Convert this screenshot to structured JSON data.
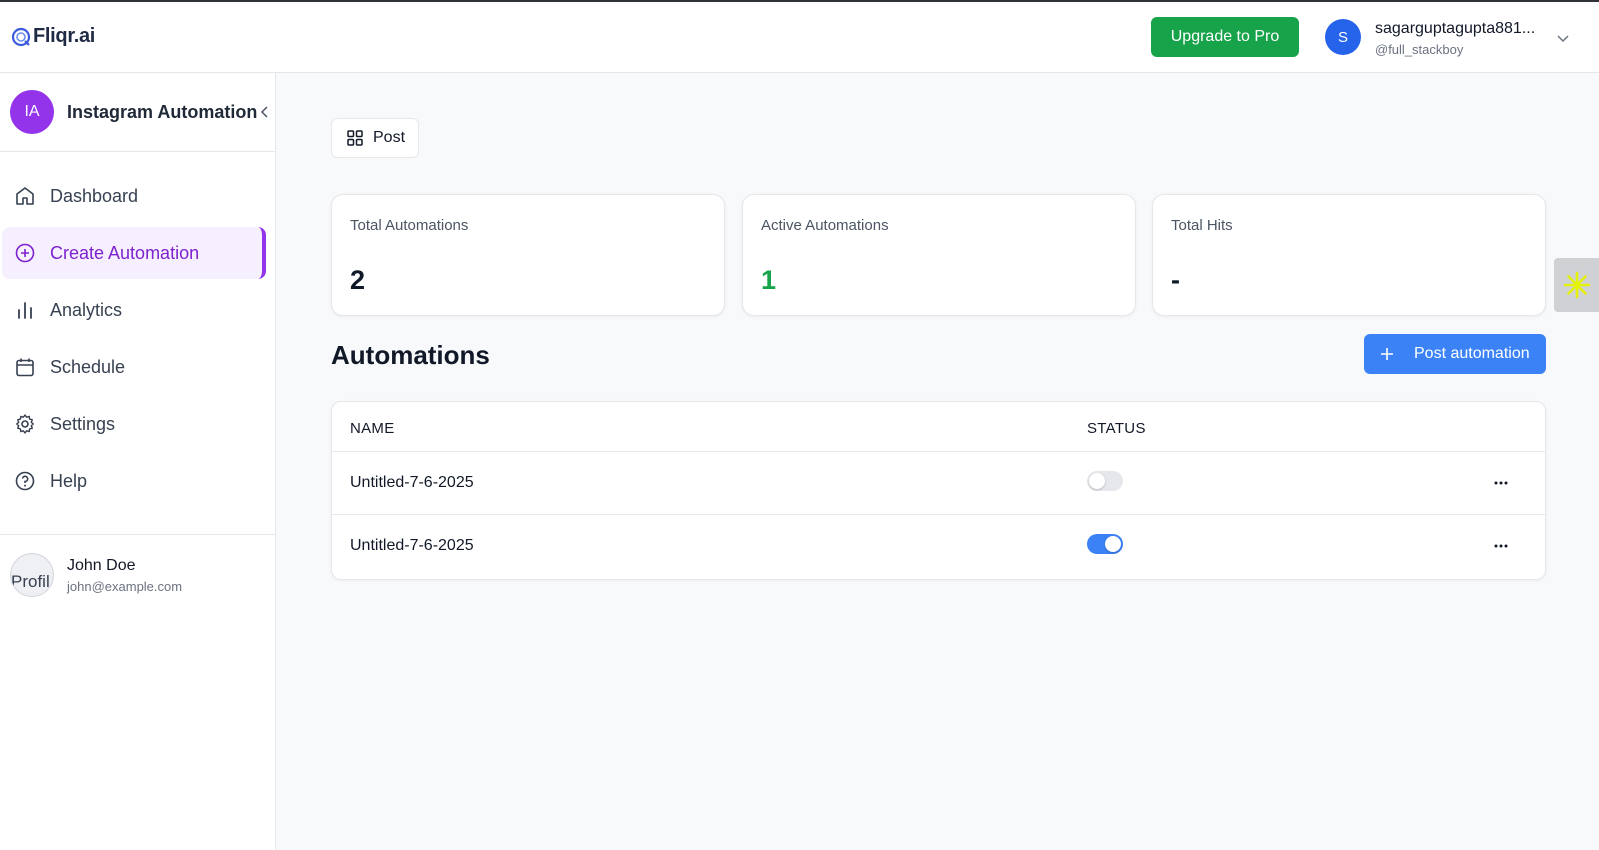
{
  "header": {
    "logo_text": "Fliqr.ai",
    "upgrade_label": "Upgrade to Pro",
    "user": {
      "initial": "S",
      "name": "sagarguptagupta881...",
      "handle": "@full_stackboy"
    }
  },
  "sidebar": {
    "workspace": {
      "initials": "IA",
      "name": "Instagram Automation"
    },
    "items": [
      {
        "label": "Dashboard",
        "icon": "home-icon",
        "active": false
      },
      {
        "label": "Create Automation",
        "icon": "plus-circle-icon",
        "active": true
      },
      {
        "label": "Analytics",
        "icon": "bar-chart-icon",
        "active": false
      },
      {
        "label": "Schedule",
        "icon": "calendar-icon",
        "active": false
      },
      {
        "label": "Settings",
        "icon": "gear-icon",
        "active": false
      },
      {
        "label": "Help",
        "icon": "help-circle-icon",
        "active": false
      }
    ],
    "profile": {
      "image_alt": "Profil",
      "name": "John Doe",
      "email": "john@example.com"
    }
  },
  "main": {
    "tab_label": "Post",
    "stats": [
      {
        "label": "Total Automations",
        "value": "2",
        "color": "#111827"
      },
      {
        "label": "Active Automations",
        "value": "1",
        "color": "#16a34a"
      },
      {
        "label": "Total Hits",
        "value": "-",
        "color": "#111827"
      }
    ],
    "section_title": "Automations",
    "new_button_label": "Post automation",
    "table": {
      "columns": [
        "NAME",
        "STATUS"
      ],
      "rows": [
        {
          "name": "Untitled-7-6-2025",
          "status_on": false
        },
        {
          "name": "Untitled-7-6-2025",
          "status_on": true
        }
      ]
    }
  },
  "colors": {
    "brand_purple": "#9333ea",
    "upgrade_green": "#16a34a",
    "primary_blue": "#3b82f6"
  }
}
